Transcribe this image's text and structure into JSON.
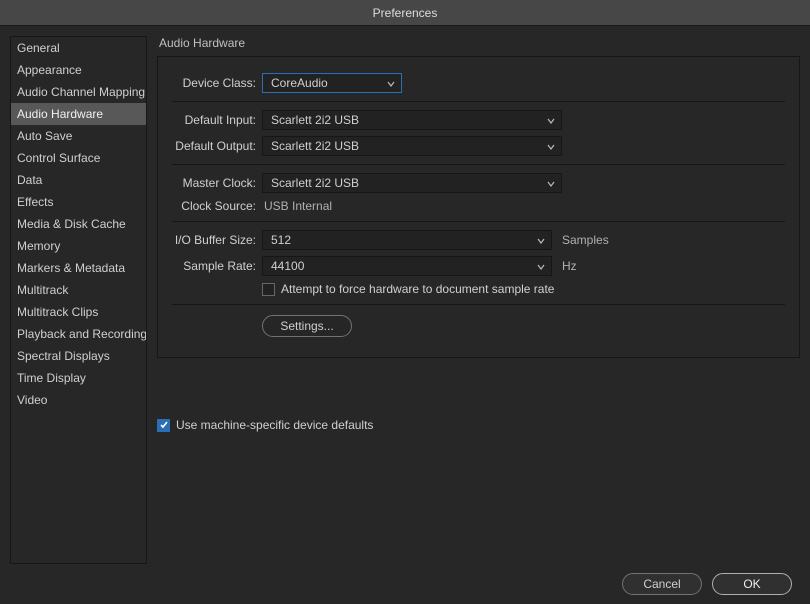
{
  "window": {
    "title": "Preferences"
  },
  "sidebar": {
    "items": [
      {
        "label": "General"
      },
      {
        "label": "Appearance"
      },
      {
        "label": "Audio Channel Mapping"
      },
      {
        "label": "Audio Hardware",
        "selected": true
      },
      {
        "label": "Auto Save"
      },
      {
        "label": "Control Surface"
      },
      {
        "label": "Data"
      },
      {
        "label": "Effects"
      },
      {
        "label": "Media & Disk Cache"
      },
      {
        "label": "Memory"
      },
      {
        "label": "Markers & Metadata"
      },
      {
        "label": "Multitrack"
      },
      {
        "label": "Multitrack Clips"
      },
      {
        "label": "Playback and Recording"
      },
      {
        "label": "Spectral Displays"
      },
      {
        "label": "Time Display"
      },
      {
        "label": "Video"
      }
    ]
  },
  "main": {
    "section_title": "Audio Hardware",
    "device_class": {
      "label": "Device Class:",
      "value": "CoreAudio"
    },
    "default_input": {
      "label": "Default Input:",
      "value": "Scarlett 2i2 USB"
    },
    "default_output": {
      "label": "Default Output:",
      "value": "Scarlett 2i2 USB"
    },
    "master_clock": {
      "label": "Master Clock:",
      "value": "Scarlett 2i2 USB"
    },
    "clock_source": {
      "label": "Clock Source:",
      "value": "USB Internal"
    },
    "io_buffer": {
      "label": "I/O Buffer Size:",
      "value": "512",
      "unit": "Samples"
    },
    "sample_rate": {
      "label": "Sample Rate:",
      "value": "44100",
      "unit": "Hz"
    },
    "force_hw": {
      "label": "Attempt to force hardware to document sample rate",
      "checked": false
    },
    "settings_btn": "Settings...",
    "machine_defaults": {
      "label": "Use machine-specific device defaults",
      "checked": true
    },
    "footer": {
      "cancel": "Cancel",
      "ok": "OK"
    }
  }
}
